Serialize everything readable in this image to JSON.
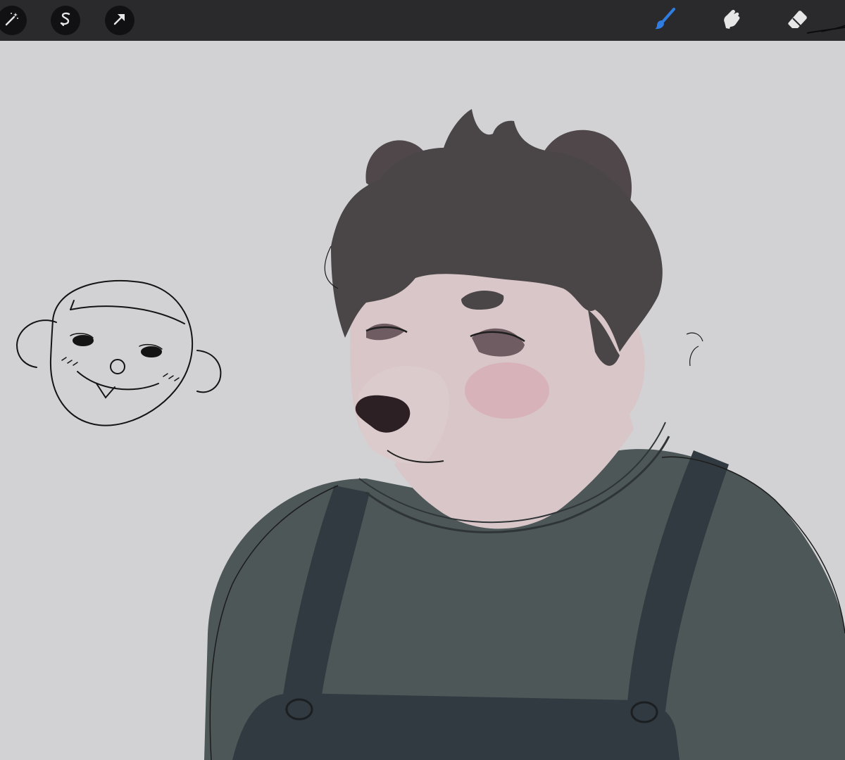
{
  "app": {
    "toolbar": {
      "left_tools": [
        {
          "name": "adjustments",
          "icon": "magic-wand-icon"
        },
        {
          "name": "selection",
          "icon": "selection-s-icon"
        },
        {
          "name": "transform",
          "icon": "arrow-cursor-icon"
        }
      ],
      "right_tools": [
        {
          "name": "brush",
          "icon": "brush-icon",
          "active": true
        },
        {
          "name": "smudge",
          "icon": "smudge-finger-icon",
          "active": false
        },
        {
          "name": "eraser",
          "icon": "eraser-icon",
          "active": false
        }
      ]
    },
    "colors": {
      "toolbar_bg": "#2a2a2c",
      "canvas_bg": "#d2d2d4",
      "active_tool": "#2f7de1",
      "icon_inactive": "#e6e6e6",
      "sweater": "#4d5758",
      "overalls": "#313a40",
      "skin": "#d9c6c8",
      "hair": "#4a4648",
      "nose": "#2c2025"
    }
  }
}
